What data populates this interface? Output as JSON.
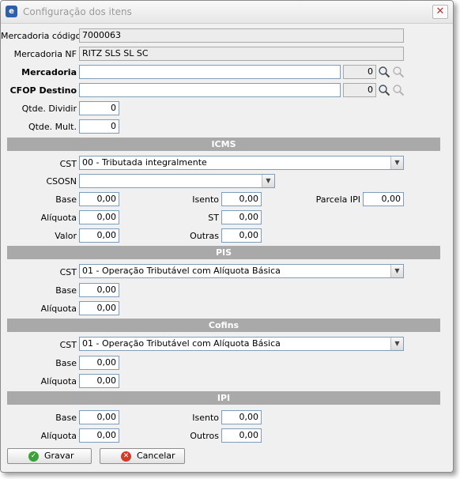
{
  "window": {
    "title": "Configuração dos itens"
  },
  "item": {
    "codigo_label": "Mercadoria código",
    "codigo_value": "7000063",
    "nf_label": "Mercadoria NF",
    "nf_value": "RITZ SLS SL SC",
    "mercadoria_label": "Mercadoria",
    "mercadoria_value": "",
    "mercadoria_code": "0",
    "cfop_label": "CFOP Destino",
    "cfop_value": "",
    "cfop_code": "0",
    "qtde_dividir_label": "Qtde. Dividir",
    "qtde_dividir_value": "0",
    "qtde_mult_label": "Qtde. Mult.",
    "qtde_mult_value": "0"
  },
  "icms": {
    "title": "ICMS",
    "cst_label": "CST",
    "cst_value": "00 - Tributada integralmente",
    "csosn_label": "CSOSN",
    "csosn_value": "",
    "base_label": "Base",
    "base_value": "0,00",
    "aliquota_label": "Alíquota",
    "aliquota_value": "0,00",
    "valor_label": "Valor",
    "valor_value": "0,00",
    "isento_label": "Isento",
    "isento_value": "0,00",
    "st_label": "ST",
    "st_value": "0,00",
    "outras_label": "Outras",
    "outras_value": "0,00",
    "parcela_ipi_label": "Parcela IPI",
    "parcela_ipi_value": "0,00"
  },
  "pis": {
    "title": "PIS",
    "cst_label": "CST",
    "cst_value": "01 - Operação Tributável com Alíquota Básica",
    "base_label": "Base",
    "base_value": "0,00",
    "aliquota_label": "Alíquota",
    "aliquota_value": "0,00"
  },
  "cofins": {
    "title": "Cofins",
    "cst_label": "CST",
    "cst_value": "01 - Operação Tributável com Alíquota Básica",
    "base_label": "Base",
    "base_value": "0,00",
    "aliquota_label": "Alíquota",
    "aliquota_value": "0,00"
  },
  "ipi": {
    "title": "IPI",
    "base_label": "Base",
    "base_value": "0,00",
    "aliquota_label": "Alíquota",
    "aliquota_value": "0,00",
    "isento_label": "Isento",
    "isento_value": "0,00",
    "outros_label": "Outros",
    "outros_value": "0,00"
  },
  "buttons": {
    "save_label": "Gravar",
    "cancel_label": "Cancelar"
  },
  "colors": {
    "section_bar": "#a9a9a9",
    "save_icon": "#3aa13a",
    "cancel_icon": "#d23a2a",
    "input_border": "#7f9db9"
  }
}
